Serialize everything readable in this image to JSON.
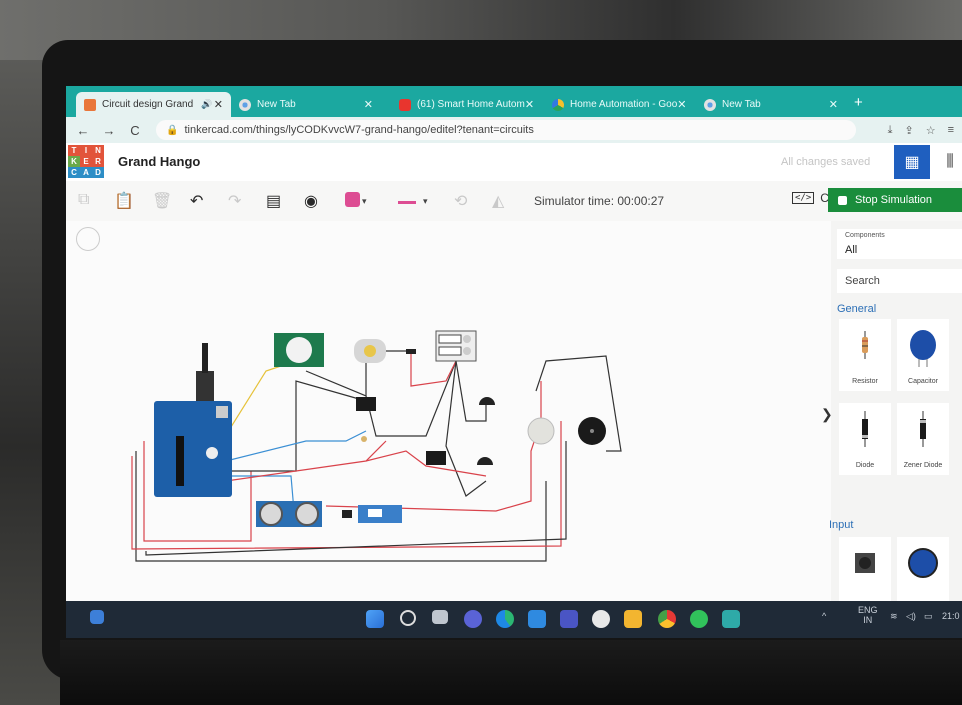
{
  "browser": {
    "tabs": [
      {
        "title": "Circuit design Grand",
        "icon": "tinkercad-icon",
        "active": true
      },
      {
        "title": "New Tab",
        "icon": "chrome-icon",
        "active": false
      },
      {
        "title": "(61) Smart Home Autom",
        "icon": "youtube-icon",
        "active": false
      },
      {
        "title": "Home Automation - Goo",
        "icon": "drive-icon",
        "active": false
      },
      {
        "title": "New Tab",
        "icon": "chrome-icon",
        "active": false
      }
    ],
    "new_tab": "+",
    "close": "✕",
    "url": "tinkercad.com/things/lyCODKvvcW7-grand-hango/editel?tenant=circuits"
  },
  "app": {
    "logo": [
      "T",
      "I",
      "N",
      "K",
      "E",
      "R",
      "C",
      "A",
      "D"
    ],
    "project_title": "Grand Hango",
    "saved_status": "All changes saved"
  },
  "toolbar": {
    "simulator_time": "Simulator time: 00:00:27",
    "code_label": "Code",
    "stop_label": "Stop Simulation"
  },
  "panel": {
    "components_label": "Components",
    "components_value": "All",
    "search_placeholder": "Search",
    "general_label": "General",
    "input_label": "Input",
    "items": [
      {
        "label": "Resistor",
        "icon": "resistor-icon"
      },
      {
        "label": "Capacitor",
        "icon": "capacitor-icon"
      },
      {
        "label": "Diode",
        "icon": "diode-icon"
      },
      {
        "label": "Zener Diode",
        "icon": "zener-diode-icon"
      }
    ]
  },
  "taskbar": {
    "lang": "ENG",
    "region": "IN",
    "clock": "21:0"
  },
  "colors": {
    "tab_strip": "#1ba8a0",
    "stop_button": "#1a8d3c",
    "active_view": "#1f5fbf",
    "wire_red": "#d9434b",
    "wire_black": "#333333",
    "wire_blue": "#3b8fd4",
    "wire_yellow": "#e6c23a",
    "arduino_blue": "#1d5fa8"
  }
}
